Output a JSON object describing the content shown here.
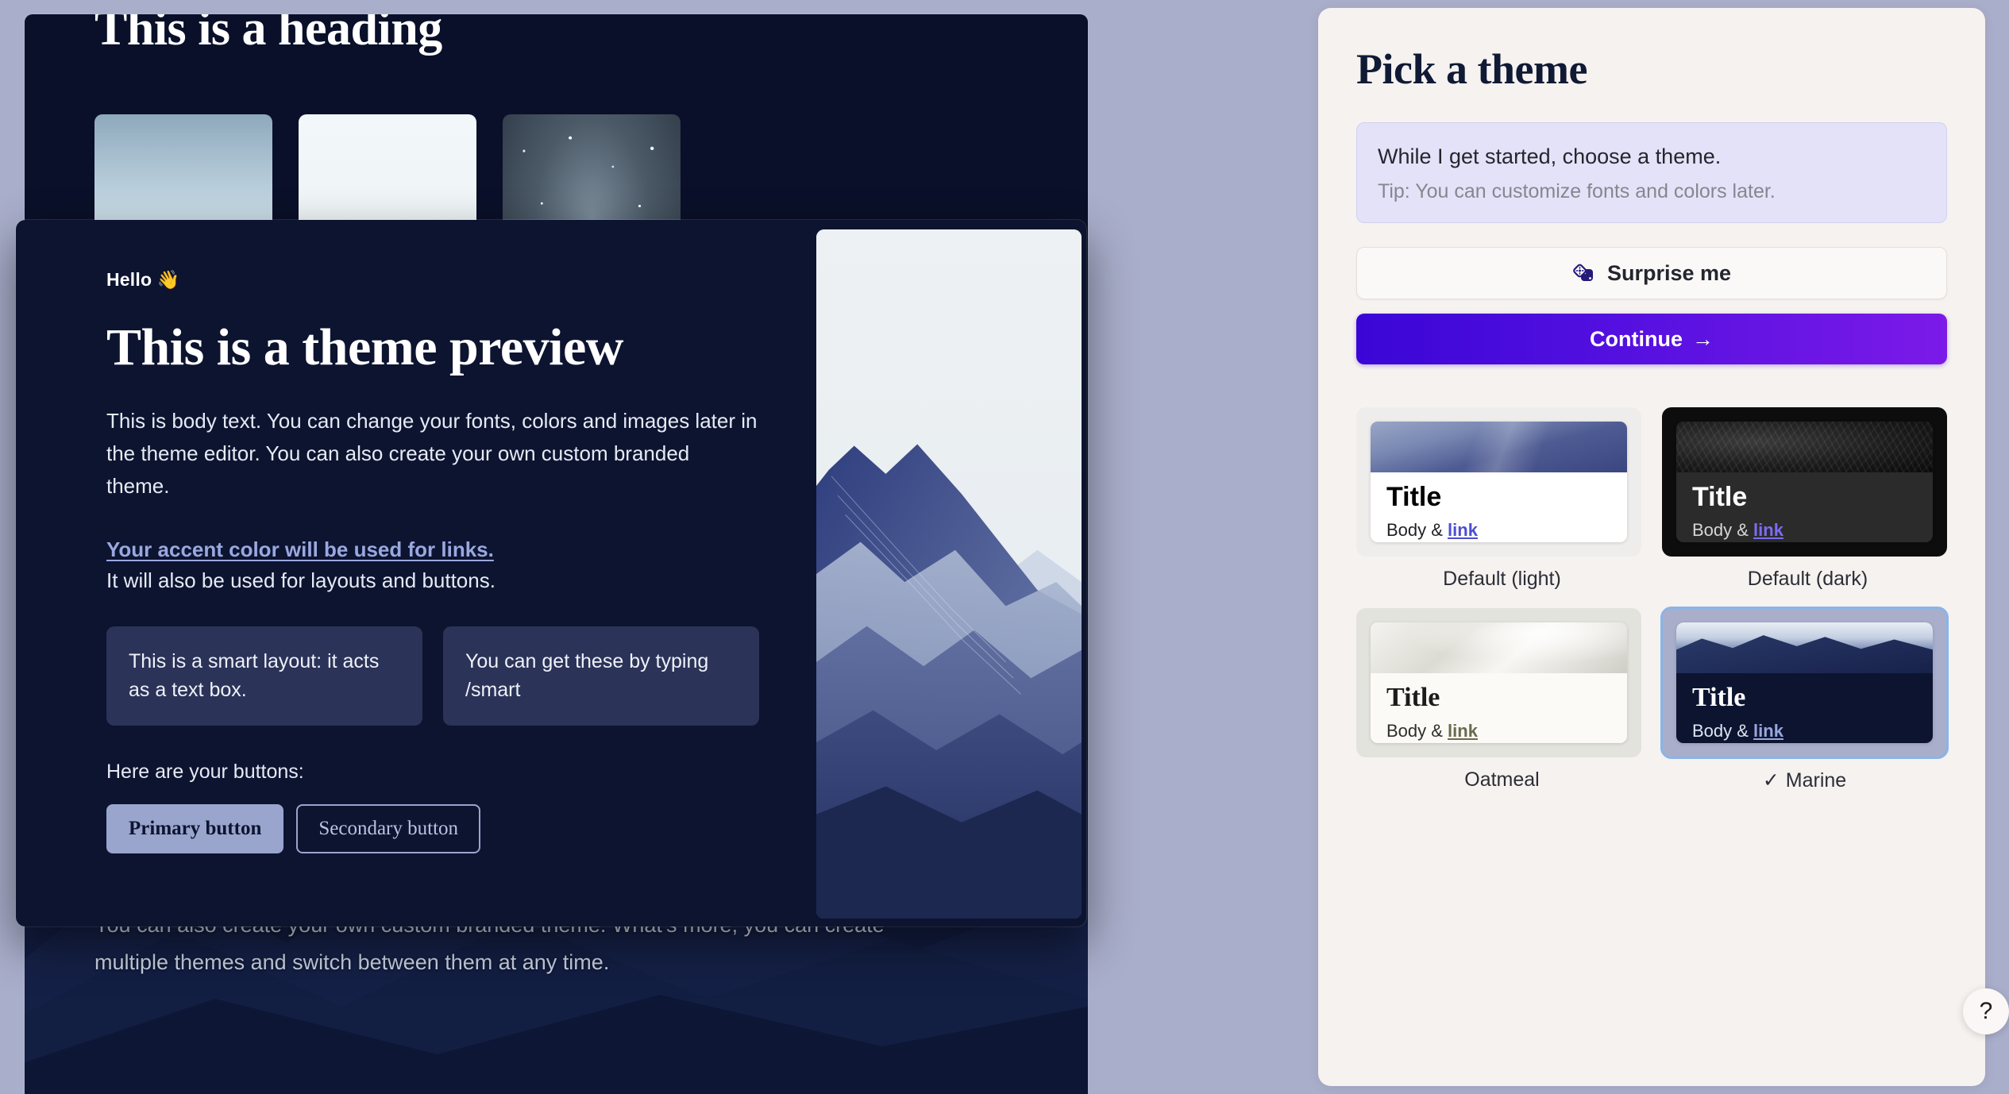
{
  "colors": {
    "background": "#a9aecb",
    "canvas_dark": "#0a1029",
    "panel_bg": "#f6f2f0",
    "tip_bg": "#e4e2f8",
    "accent_primary": "#5410e0",
    "accent_link": "#9aa8e0",
    "selected_outline": "#8ab4e8"
  },
  "canvas": {
    "heading": "This is a heading",
    "body": "This is body text. You can change your fonts, colors and images later in the theme editor. You can also create your own custom branded theme. What's more, you can create multiple themes and switch between them at any time.",
    "thumbnails": [
      {
        "name": "mountain-peak-photo"
      },
      {
        "name": "person-in-white-hood-photo"
      },
      {
        "name": "starry-night-sky-photo"
      }
    ]
  },
  "preview": {
    "greeting": "Hello 👋",
    "title": "This is a theme preview",
    "body": "This is body text. You can change your fonts, colors and images later in the theme editor. You can also create your own custom branded theme.",
    "accent_link": "Your accent color will be used for links.",
    "accent_sub": "It will also be used for layouts and buttons.",
    "smart_layouts": [
      "This is a smart layout: it acts as a text box.",
      "You can get these by typing /smart"
    ],
    "buttons_label": "Here are your buttons:",
    "primary_button": "Primary button",
    "secondary_button": "Secondary button",
    "image_name": "layered-mountains-illustration"
  },
  "panel": {
    "title": "Pick a theme",
    "tip": {
      "main": "While I get started, choose a theme.",
      "sub": "Tip: You can customize fonts and colors later."
    },
    "surprise_label": "Surprise me",
    "surprise_icon": "dice-icon",
    "continue_label": "Continue",
    "continue_icon": "arrow-right-icon",
    "mini_preview": {
      "title": "Title",
      "body": "Body & ",
      "link": "link"
    },
    "themes": [
      {
        "id": "default-light",
        "label": "Default (light)",
        "selected": false,
        "check": ""
      },
      {
        "id": "default-dark",
        "label": "Default (dark)",
        "selected": false,
        "check": ""
      },
      {
        "id": "oatmeal",
        "label": "Oatmeal",
        "selected": false,
        "check": ""
      },
      {
        "id": "marine",
        "label": "Marine",
        "selected": true,
        "check": "✓"
      }
    ]
  },
  "help": {
    "label": "?",
    "icon": "question-mark-icon"
  }
}
